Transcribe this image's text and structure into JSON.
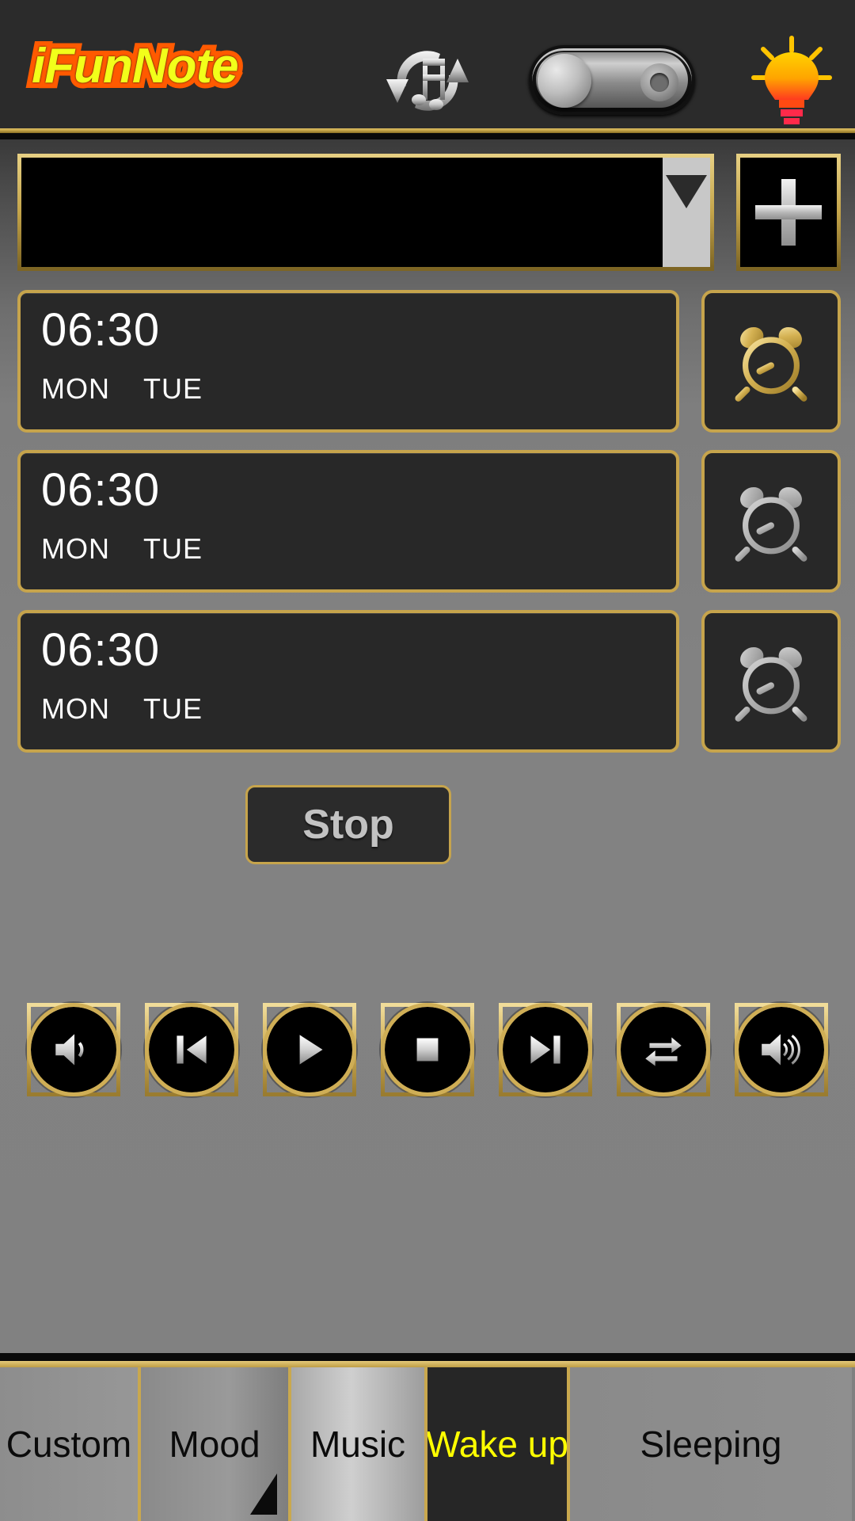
{
  "app": {
    "name": "iFunNote",
    "header_icons": {
      "sync": "music-sync-icon",
      "toggle": "power-toggle-switch",
      "bulb": "light-bulb-icon"
    }
  },
  "selector": {
    "value": "",
    "placeholder": "",
    "arrow_icon": "chevron-down-icon",
    "add_label": "+"
  },
  "alarms": [
    {
      "time": "06:30",
      "days": [
        "MON",
        "TUE"
      ],
      "enabled": true,
      "icon": "alarm-clock-icon"
    },
    {
      "time": "06:30",
      "days": [
        "MON",
        "TUE"
      ],
      "enabled": false,
      "icon": "alarm-clock-icon"
    },
    {
      "time": "06:30",
      "days": [
        "MON",
        "TUE"
      ],
      "enabled": false,
      "icon": "alarm-clock-icon"
    }
  ],
  "stop": {
    "label": "Stop"
  },
  "media_controls": [
    {
      "name": "volume-down-icon",
      "label": "Volume Down"
    },
    {
      "name": "previous-track-icon",
      "label": "Previous"
    },
    {
      "name": "play-icon",
      "label": "Play"
    },
    {
      "name": "stop-icon",
      "label": "Stop"
    },
    {
      "name": "next-track-icon",
      "label": "Next"
    },
    {
      "name": "repeat-icon",
      "label": "Repeat"
    },
    {
      "name": "volume-up-icon",
      "label": "Volume Up"
    }
  ],
  "tabs": [
    {
      "label": "Custom",
      "active": false,
      "marker": false
    },
    {
      "label": "Mood",
      "active": false,
      "marker": true
    },
    {
      "label": "Music",
      "active": false,
      "marker": false
    },
    {
      "label": "Wake up",
      "active": true,
      "marker": false
    },
    {
      "label": "Sleeping",
      "active": false,
      "marker": false
    }
  ],
  "colors": {
    "gold": "#c6a44c",
    "accent_yellow": "#ffff00",
    "logo_fill": "#f2ff1a",
    "logo_stroke": "#ff5a00",
    "header_bg": "#2b2b2b",
    "body_bg": "#808080",
    "card_bg": "#282828"
  }
}
